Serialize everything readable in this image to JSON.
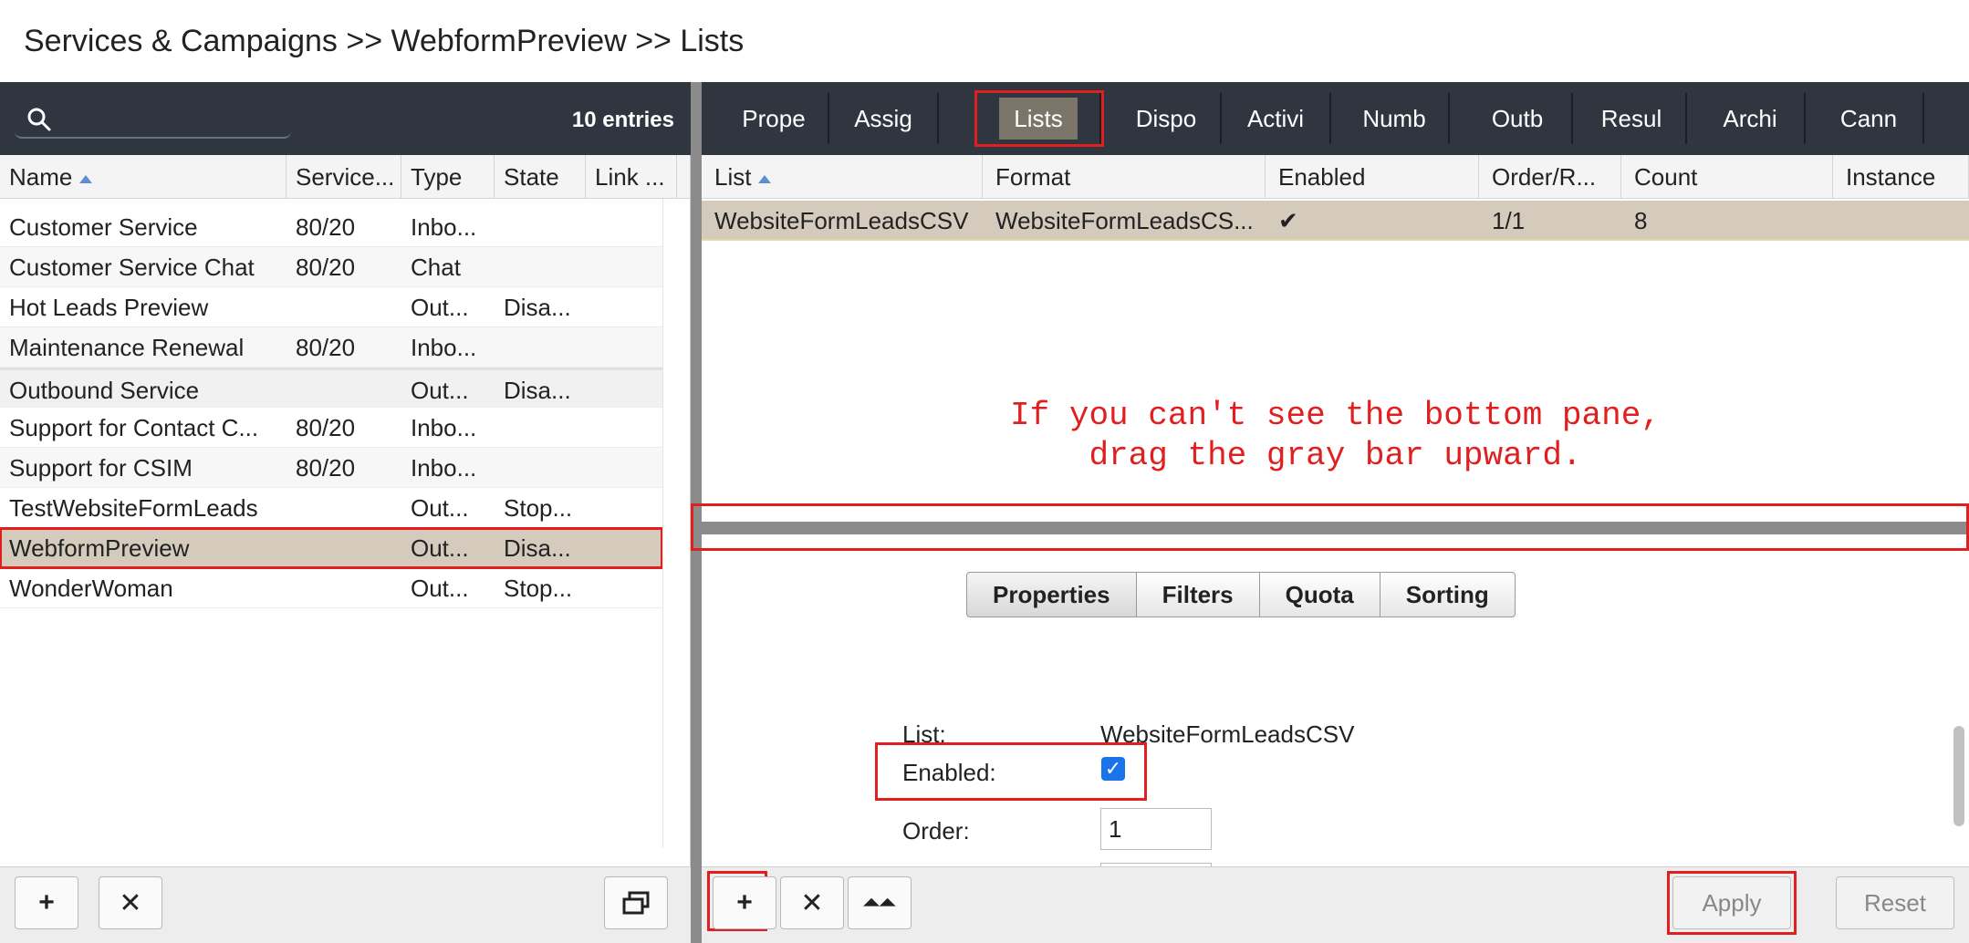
{
  "breadcrumb": "Services & Campaigns >> WebformPreview >> Lists",
  "left": {
    "entries": "10 entries",
    "columns": [
      "Name",
      "Service...",
      "Type",
      "State",
      "Link ..."
    ],
    "rows": [
      {
        "name": "Customer Service",
        "service": "80/20",
        "type": "Inbo...",
        "state": ""
      },
      {
        "name": "Customer Service Chat",
        "service": "80/20",
        "type": "Chat",
        "state": ""
      },
      {
        "name": "Hot Leads Preview",
        "service": "",
        "type": "Out...",
        "state": "Disa..."
      },
      {
        "name": "Maintenance Renewal",
        "service": "80/20",
        "type": "Inbo...",
        "state": ""
      },
      {
        "name": "Outbound Service",
        "service": "",
        "type": "Out...",
        "state": "Disa..."
      },
      {
        "name": "Support for Contact C...",
        "service": "80/20",
        "type": "Inbo...",
        "state": ""
      },
      {
        "name": "Support for CSIM",
        "service": "80/20",
        "type": "Inbo...",
        "state": ""
      },
      {
        "name": "TestWebsiteFormLeads",
        "service": "",
        "type": "Out...",
        "state": "Stop..."
      },
      {
        "name": "WebformPreview",
        "service": "",
        "type": "Out...",
        "state": "Disa..."
      },
      {
        "name": "WonderWoman",
        "service": "",
        "type": "Out...",
        "state": "Stop..."
      }
    ],
    "footer": {
      "add": "+",
      "delete": "✕",
      "window": "⧉"
    }
  },
  "tabs": [
    "Prope",
    "Assig",
    "Lists",
    "Dispo",
    "Activi",
    "Numb",
    "Outb",
    "Resul",
    "Archi",
    "Cann"
  ],
  "lists_table": {
    "columns": [
      "List",
      "Format",
      "Enabled",
      "Order/R...",
      "Count",
      "Instance"
    ],
    "row": {
      "list": "WebsiteFormLeadsCSV",
      "format": "WebsiteFormLeadsCS...",
      "enabled": "✔",
      "order": "1/1",
      "count": "8",
      "instance": ""
    }
  },
  "hint": {
    "line1": "If you can't see the bottom pane,",
    "line2": "drag the gray bar upward."
  },
  "steps": [
    "Properties",
    "Filters",
    "Quota",
    "Sorting"
  ],
  "form": {
    "list_label": "List:",
    "list_value": "WebsiteFormLeadsCSV",
    "enabled_label": "Enabled:",
    "enabled_mark": "✓",
    "order_label": "Order:",
    "order_value": "1"
  },
  "right_footer": {
    "add": "+",
    "delete": "✕",
    "top": "⏶⏶",
    "apply": "Apply",
    "reset": "Reset"
  },
  "colors": {
    "toolbar": "#2f3640",
    "selected_row": "#d4cbbd",
    "annotation": "#e02020",
    "checkbox": "#1a73e8"
  }
}
